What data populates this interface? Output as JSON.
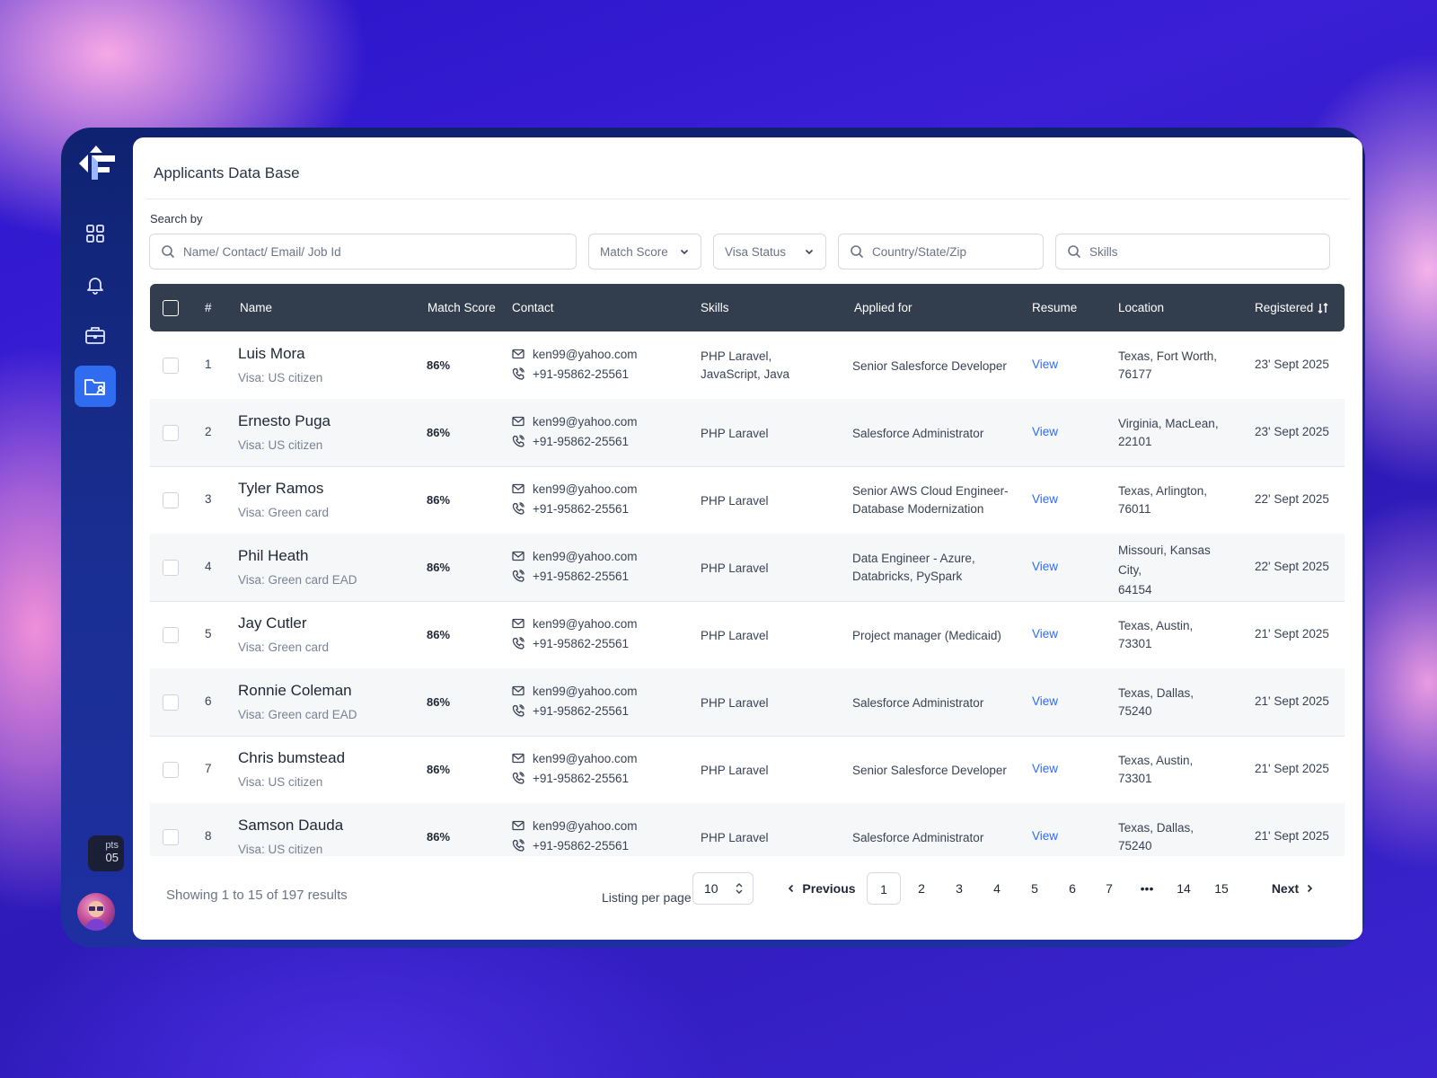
{
  "app": {
    "title": "Applicants Data Base",
    "credits": {
      "label": "pts",
      "value": "05"
    }
  },
  "sidebar": {
    "items": [
      {
        "name": "dashboard",
        "icon": "grid-icon",
        "active": false
      },
      {
        "name": "notifications",
        "icon": "bell-icon",
        "active": false
      },
      {
        "name": "jobs",
        "icon": "briefcase-icon",
        "active": false
      },
      {
        "name": "applicants",
        "icon": "folder-user-icon",
        "active": true
      }
    ]
  },
  "search": {
    "label": "Search by",
    "query_placeholder": "Name/ Contact/ Email/ Job Id",
    "match_score_label": "Match Score",
    "visa_status_label": "Visa Status",
    "location_placeholder": "Country/State/Zip",
    "skills_placeholder": "Skills"
  },
  "table": {
    "columns": {
      "index": "#",
      "name": "Name",
      "match_score": "Match Score",
      "contact": "Contact",
      "skills": "Skills",
      "applied_for": "Applied for",
      "resume": "Resume",
      "location": "Location",
      "registered": "Registered"
    },
    "rows": [
      {
        "n": "1",
        "name": "Luis Mora",
        "visa": "Visa: US citizen",
        "score": "86%",
        "email": "ken99@yahoo.com",
        "phone": "+91-95862-25561",
        "skills_l1": "PHP Laravel,",
        "skills_l2": "JavaScript, Java",
        "applied_l1": "Senior Salesforce Developer",
        "applied_l2": "",
        "resume": "View",
        "loc_l1": "Texas, Fort Worth,",
        "loc_l2": "76177",
        "loc_l3": "",
        "registered": "23' Sept 2025"
      },
      {
        "n": "2",
        "name": "Ernesto Puga",
        "visa": "Visa: US citizen",
        "score": "86%",
        "email": "ken99@yahoo.com",
        "phone": "+91-95862-25561",
        "skills_l1": "PHP Laravel",
        "skills_l2": "",
        "applied_l1": "Salesforce Administrator",
        "applied_l2": "",
        "resume": "View",
        "loc_l1": "Virginia, MacLean,",
        "loc_l2": "22101",
        "loc_l3": "",
        "registered": "23' Sept 2025"
      },
      {
        "n": "3",
        "name": "Tyler Ramos",
        "visa": "Visa: Green card",
        "score": "86%",
        "email": "ken99@yahoo.com",
        "phone": "+91-95862-25561",
        "skills_l1": "PHP Laravel",
        "skills_l2": "",
        "applied_l1": "Senior AWS Cloud Engineer-",
        "applied_l2": "Database Modernization",
        "resume": "View",
        "loc_l1": "Texas, Arlington,",
        "loc_l2": "76011",
        "loc_l3": "",
        "registered": "22' Sept 2025"
      },
      {
        "n": "4",
        "name": "Phil Heath",
        "visa": "Visa: Green card EAD",
        "score": "86%",
        "email": "ken99@yahoo.com",
        "phone": "+91-95862-25561",
        "skills_l1": "PHP Laravel",
        "skills_l2": "",
        "applied_l1": "Data Engineer - Azure,",
        "applied_l2": "Databricks, PySpark",
        "resume": "View",
        "loc_l1": "Missouri, Kansas",
        "loc_l2": "City,",
        "loc_l3": "64154",
        "registered": "22' Sept 2025"
      },
      {
        "n": "5",
        "name": "Jay Cutler",
        "visa": "Visa: Green card",
        "score": "86%",
        "email": "ken99@yahoo.com",
        "phone": "+91-95862-25561",
        "skills_l1": "PHP Laravel",
        "skills_l2": "",
        "applied_l1": "Project manager (Medicaid)",
        "applied_l2": "",
        "resume": "View",
        "loc_l1": "Texas, Austin,",
        "loc_l2": "73301",
        "loc_l3": "",
        "registered": "21' Sept 2025"
      },
      {
        "n": "6",
        "name": "Ronnie Coleman",
        "visa": "Visa: Green card EAD",
        "score": "86%",
        "email": "ken99@yahoo.com",
        "phone": "+91-95862-25561",
        "skills_l1": "PHP Laravel",
        "skills_l2": "",
        "applied_l1": "Salesforce Administrator",
        "applied_l2": "",
        "resume": "View",
        "loc_l1": "Texas, Dallas,",
        "loc_l2": "75240",
        "loc_l3": "",
        "registered": "21' Sept 2025"
      },
      {
        "n": "7",
        "name": "Chris bumstead",
        "visa": "Visa: US citizen",
        "score": "86%",
        "email": "ken99@yahoo.com",
        "phone": "+91-95862-25561",
        "skills_l1": "PHP Laravel",
        "skills_l2": "",
        "applied_l1": "Senior Salesforce Developer",
        "applied_l2": "",
        "resume": "View",
        "loc_l1": "Texas, Austin,",
        "loc_l2": "73301",
        "loc_l3": "",
        "registered": "21' Sept 2025"
      },
      {
        "n": "8",
        "name": "Samson Dauda",
        "visa": "Visa: US citizen",
        "score": "86%",
        "email": "ken99@yahoo.com",
        "phone": "+91-95862-25561",
        "skills_l1": "PHP Laravel",
        "skills_l2": "",
        "applied_l1": "Salesforce Administrator",
        "applied_l2": "",
        "resume": "View",
        "loc_l1": "Texas, Dallas,",
        "loc_l2": "75240",
        "loc_l3": "",
        "registered": "21' Sept 2025"
      }
    ]
  },
  "pagination": {
    "showing": "Showing 1 to 15 of 197 results",
    "per_page_label": "Listing per page",
    "per_page_value": "10",
    "previous": "Previous",
    "next": "Next",
    "pages": [
      "1",
      "2",
      "3",
      "4",
      "5",
      "6",
      "7",
      "•••",
      "14",
      "15"
    ],
    "current": "1"
  },
  "colors": {
    "accent": "#2f6cf0",
    "header_bg": "#323d4e",
    "sidebar_bg": "#0f2270"
  }
}
